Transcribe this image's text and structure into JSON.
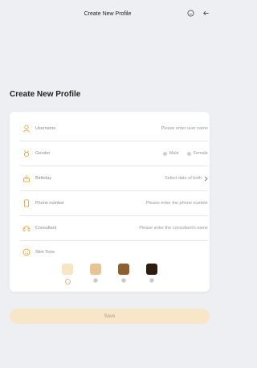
{
  "header": {
    "title": "Create New Profile",
    "home_icon": "home-icon",
    "back_icon": "back-arrow-icon"
  },
  "page": {
    "heading": "Create New Profile"
  },
  "form": {
    "username": {
      "label": "Username",
      "placeholder": "Please enter user name",
      "icon": "person-icon"
    },
    "gender": {
      "label": "Gender",
      "options": [
        "Male",
        "Female"
      ],
      "icon": "gender-icon"
    },
    "birthday": {
      "label": "Birthday",
      "placeholder": "Select date of birth",
      "icon": "cake-icon"
    },
    "phone": {
      "label": "Phone number",
      "placeholder": "Please enter the phone number",
      "icon": "phone-icon"
    },
    "consultant": {
      "label": "Consultant",
      "placeholder": "Please enter the consultant's name",
      "icon": "headset-icon"
    },
    "skin_tone": {
      "label": "Skin Tone",
      "icon": "face-icon",
      "swatches": [
        "#f7e6c4",
        "#e8c393",
        "#8e5f30",
        "#2d1d0e"
      ],
      "selected_index": 0
    }
  },
  "actions": {
    "save_label": "Save"
  },
  "colors": {
    "accent": "#e4bd80",
    "save_bg": "#f8e6c8",
    "background": "#eeeff2"
  }
}
